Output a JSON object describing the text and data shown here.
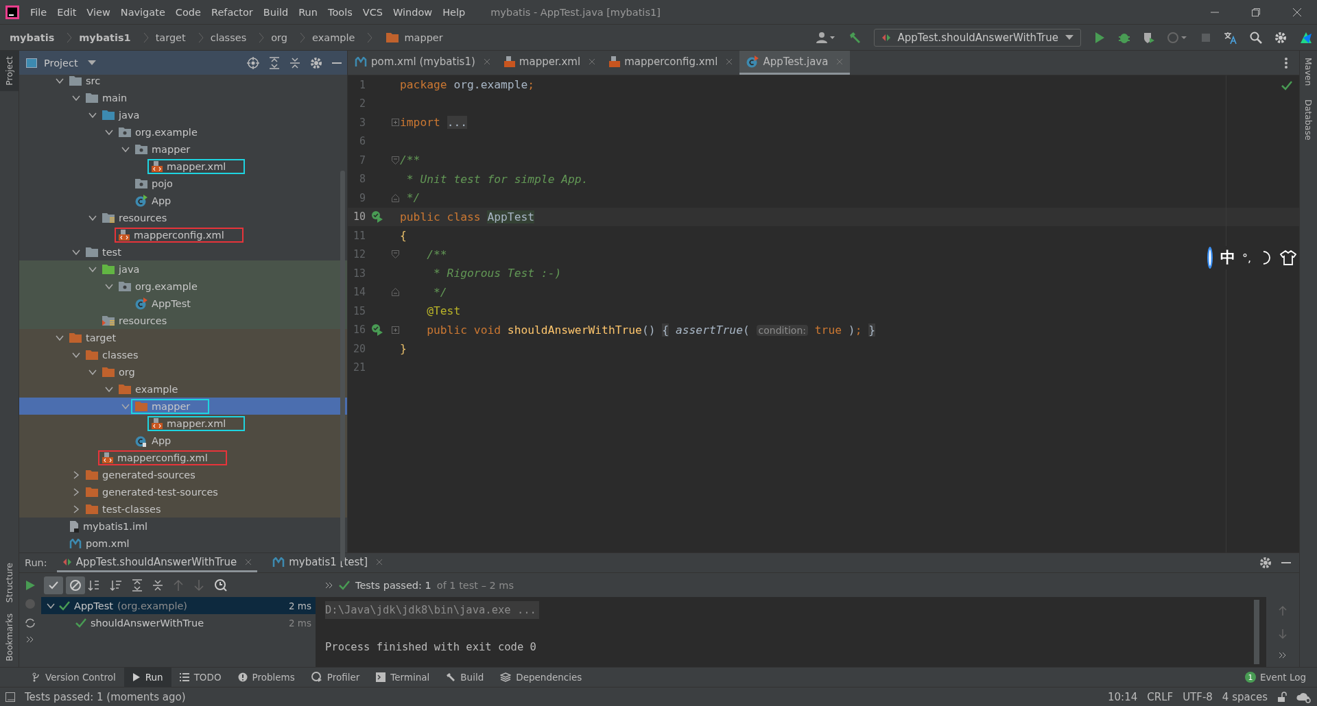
{
  "window": {
    "title": "mybatis - AppTest.java [mybatis1]"
  },
  "menu": [
    "File",
    "Edit",
    "View",
    "Navigate",
    "Code",
    "Refactor",
    "Build",
    "Run",
    "Tools",
    "VCS",
    "Window",
    "Help"
  ],
  "breadcrumbs": [
    {
      "label": "mybatis",
      "bold": true,
      "kind": "plain"
    },
    {
      "label": "mybatis1",
      "bold": true,
      "kind": "plain"
    },
    {
      "label": "target",
      "bold": false,
      "kind": "plain"
    },
    {
      "label": "classes",
      "bold": false,
      "kind": "plain"
    },
    {
      "label": "org",
      "bold": false,
      "kind": "plain"
    },
    {
      "label": "example",
      "bold": false,
      "kind": "plain"
    },
    {
      "label": "mapper",
      "bold": false,
      "kind": "folder"
    }
  ],
  "toolbar": {
    "run_config": "AppTest.shouldAnswerWithTrue"
  },
  "left_stripe": [
    "Project",
    "Structure",
    "Bookmarks"
  ],
  "right_stripe": [
    "Maven",
    "Database"
  ],
  "project_panel": {
    "title": "Project",
    "tree": [
      {
        "label": "src",
        "kind": "folder",
        "expanded": true,
        "selected": false,
        "children": [
          {
            "label": "main",
            "kind": "folder",
            "expanded": true,
            "selected": false,
            "children": [
              {
                "label": "java",
                "kind": "source",
                "expanded": true,
                "selected": false,
                "children": [
                  {
                    "label": "org.example",
                    "kind": "package",
                    "expanded": true,
                    "selected": false,
                    "children": [
                      {
                        "label": "mapper",
                        "kind": "package",
                        "expanded": true,
                        "selected": false,
                        "children": [
                          {
                            "label": "mapper.xml",
                            "kind": "xml",
                            "selected": false,
                            "color": "#1ed4e0"
                          }
                        ]
                      },
                      {
                        "label": "pojo",
                        "kind": "package",
                        "selected": false
                      },
                      {
                        "label": "App",
                        "kind": "class",
                        "selected": false
                      }
                    ]
                  }
                ]
              },
              {
                "label": "resources",
                "kind": "resources",
                "expanded": true,
                "selected": false,
                "children": [
                  {
                    "label": "mapperconfig.xml",
                    "kind": "xml",
                    "selected": false,
                    "color": "#e8343a"
                  }
                ]
              }
            ]
          },
          {
            "label": "test",
            "kind": "folder",
            "expanded": true,
            "selected": false,
            "children": [
              {
                "label": "java",
                "kind": "test-source",
                "test_scope": true,
                "expanded": true,
                "selected": false,
                "children": [
                  {
                    "label": "org.example",
                    "kind": "package",
                    "test_scope": true,
                    "expanded": true,
                    "selected": false,
                    "children": [
                      {
                        "label": "AppTest",
                        "kind": "test-class",
                        "test_scope": true,
                        "selected": false
                      }
                    ]
                  }
                ]
              },
              {
                "label": "resources",
                "kind": "test-resources",
                "test_scope": true,
                "selected": false
              }
            ]
          }
        ]
      },
      {
        "label": "target",
        "kind": "excluded",
        "excluded": true,
        "expanded": true,
        "selected": false,
        "children": [
          {
            "label": "classes",
            "kind": "excluded",
            "excluded": true,
            "expanded": true,
            "selected": false,
            "children": [
              {
                "label": "org",
                "kind": "excluded",
                "excluded": true,
                "expanded": true,
                "selected": false,
                "children": [
                  {
                    "label": "example",
                    "kind": "excluded",
                    "excluded": true,
                    "expanded": true,
                    "selected": false,
                    "children": [
                      {
                        "label": "mapper",
                        "kind": "excluded",
                        "excluded": true,
                        "expanded": true,
                        "selected": true,
                        "color": "#1ed4e0",
                        "children": [
                          {
                            "label": "mapper.xml",
                            "kind": "xml",
                            "excluded": true,
                            "selected": false,
                            "color": "#1ed4e0"
                          }
                        ]
                      },
                      {
                        "label": "App",
                        "kind": "compiled-class",
                        "excluded": true,
                        "selected": false
                      }
                    ]
                  }
                ]
              },
              {
                "label": "mapperconfig.xml",
                "kind": "xml",
                "excluded": true,
                "selected": false,
                "color": "#e8343a"
              }
            ]
          },
          {
            "label": "generated-sources",
            "kind": "excluded",
            "excluded": true,
            "expanded": false,
            "selected": false
          },
          {
            "label": "generated-test-sources",
            "kind": "excluded",
            "excluded": true,
            "expanded": false,
            "selected": false
          },
          {
            "label": "test-classes",
            "kind": "excluded",
            "excluded": true,
            "expanded": false,
            "selected": false
          }
        ]
      },
      {
        "label": "mybatis1.iml",
        "kind": "iml",
        "selected": false
      },
      {
        "label": "pom.xml",
        "kind": "maven",
        "selected": false
      }
    ]
  },
  "editor": {
    "tabs": [
      {
        "label": "pom.xml (mybatis1)",
        "kind": "maven",
        "selected": false
      },
      {
        "label": "mapper.xml",
        "kind": "xml",
        "selected": false
      },
      {
        "label": "mapperconfig.xml",
        "kind": "xml",
        "selected": false
      },
      {
        "label": "AppTest.java",
        "kind": "test-class",
        "selected": true
      }
    ],
    "lines": [
      {
        "number": "1",
        "current": false,
        "run_marker": false,
        "segments": [
          {
            "text": "package ",
            "kind": "keyword"
          },
          {
            "text": "org.example",
            "kind": "plain"
          },
          {
            "text": ";",
            "kind": "keyword"
          }
        ]
      },
      {
        "number": "2",
        "current": false,
        "run_marker": false
      },
      {
        "number": "3",
        "current": false,
        "run_marker": false,
        "fold": {
          "kind": "collapsed"
        },
        "segments": [
          {
            "text": "import ",
            "kind": "keyword"
          },
          {
            "text": "...",
            "kind": "folded"
          }
        ]
      },
      {
        "number": "6",
        "current": false,
        "run_marker": false
      },
      {
        "number": "7",
        "current": false,
        "run_marker": false,
        "fold": {
          "kind": "open"
        },
        "segments": [
          {
            "text": "/**",
            "kind": "comment"
          }
        ]
      },
      {
        "number": "8",
        "current": false,
        "run_marker": false,
        "segments": [
          {
            "text": " * Unit test for simple App.",
            "kind": "comment"
          }
        ]
      },
      {
        "number": "9",
        "current": false,
        "run_marker": false,
        "fold": {
          "kind": "close"
        },
        "segments": [
          {
            "text": " */",
            "kind": "comment"
          }
        ]
      },
      {
        "number": "10",
        "current": true,
        "run_marker": true,
        "segments": [
          {
            "text": "public class ",
            "kind": "keyword"
          },
          {
            "text": "AppTest",
            "kind": "declaration"
          }
        ]
      },
      {
        "number": "11",
        "current": false,
        "run_marker": false,
        "segments": [
          {
            "text": "{",
            "kind": "brace"
          }
        ]
      },
      {
        "number": "12",
        "current": false,
        "run_marker": false,
        "fold": {
          "kind": "open"
        },
        "segments": [
          {
            "text": "    /**",
            "kind": "comment"
          }
        ]
      },
      {
        "number": "13",
        "current": false,
        "run_marker": false,
        "segments": [
          {
            "text": "     * Rigorous Test :-)",
            "kind": "comment"
          }
        ]
      },
      {
        "number": "14",
        "current": false,
        "run_marker": false,
        "fold": {
          "kind": "close"
        },
        "segments": [
          {
            "text": "     */",
            "kind": "comment"
          }
        ]
      },
      {
        "number": "15",
        "current": false,
        "run_marker": false,
        "segments": [
          {
            "text": "    @Test",
            "kind": "annotation"
          }
        ]
      },
      {
        "number": "16",
        "current": false,
        "run_marker": true,
        "fold": {
          "kind": "collapsed"
        },
        "segments": [
          {
            "text": "    public void ",
            "kind": "keyword"
          },
          {
            "text": "shouldAnswerWithTrue",
            "kind": "method"
          },
          {
            "text": "() ",
            "kind": "plain"
          },
          {
            "text": "{",
            "kind": "folded"
          },
          {
            "text": " assertTrue",
            "kind": "static"
          },
          {
            "text": "( ",
            "kind": "plain"
          },
          {
            "text": "condition:",
            "kind": "hint"
          },
          {
            "text": " true",
            "kind": "keyword"
          },
          {
            "text": " )",
            "kind": "plain"
          },
          {
            "text": "; ",
            "kind": "keyword"
          },
          {
            "text": "}",
            "kind": "folded"
          }
        ]
      },
      {
        "number": "20",
        "current": false,
        "run_marker": false,
        "segments": [
          {
            "text": "}",
            "kind": "brace"
          }
        ]
      },
      {
        "number": "21",
        "current": false,
        "run_marker": false
      }
    ]
  },
  "ime_bar": {
    "mode": "中",
    "punctuation": "°,"
  },
  "run_panel": {
    "label": "Run:",
    "tabs": [
      {
        "label": "AppTest.shouldAnswerWithTrue",
        "kind": "test",
        "selected": true
      },
      {
        "label": "mybatis1 [test]",
        "kind": "maven",
        "selected": false
      }
    ],
    "summary": {
      "status": "Tests passed: 1",
      "detail": "of 1 test – 2 ms"
    },
    "tests": [
      {
        "name": "AppTest",
        "package": "(org.example)",
        "time": "2 ms",
        "passed": true,
        "expanded": true,
        "selected": true,
        "children": [
          {
            "name": "shouldAnswerWithTrue",
            "time": "2 ms",
            "passed": true,
            "selected": false
          }
        ]
      }
    ],
    "console": [
      {
        "text": "D:\\Java\\jdk\\jdk8\\bin\\java.exe ...",
        "kind": "command"
      },
      {
        "text": "Process finished with exit code 0",
        "kind": "output"
      }
    ]
  },
  "bottom_tabs": [
    {
      "label": "Version Control",
      "kind": "vcs",
      "selected": false
    },
    {
      "label": "Run",
      "kind": "run",
      "selected": true
    },
    {
      "label": "TODO",
      "kind": "todo",
      "selected": false
    },
    {
      "label": "Problems",
      "kind": "problems",
      "selected": false
    },
    {
      "label": "Profiler",
      "kind": "profiler",
      "selected": false
    },
    {
      "label": "Terminal",
      "kind": "terminal",
      "selected": false
    },
    {
      "label": "Build",
      "kind": "build",
      "selected": false
    },
    {
      "label": "Dependencies",
      "kind": "dependencies",
      "selected": false
    }
  ],
  "event_log": {
    "label": "Event Log",
    "count": "1"
  },
  "status_bar": {
    "message": "Tests passed: 1 (moments ago)",
    "position": "10:14",
    "line_ending": "CRLF",
    "encoding": "UTF-8",
    "indent": "4 spaces"
  }
}
